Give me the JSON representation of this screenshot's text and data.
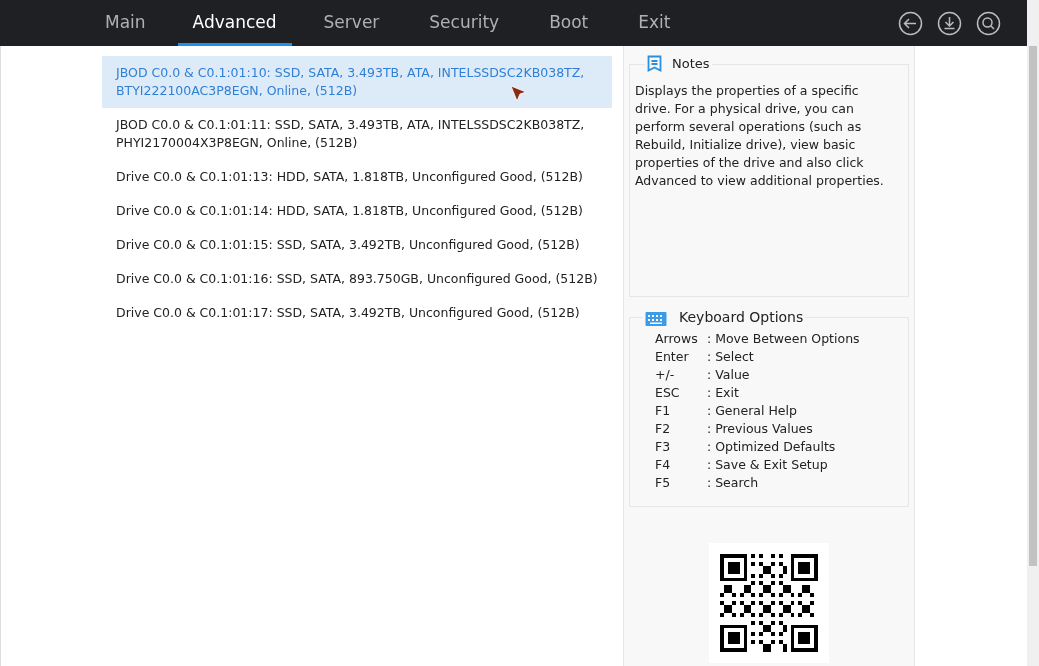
{
  "tabs": [
    {
      "label": "Main",
      "selected": false
    },
    {
      "label": "Advanced",
      "selected": true
    },
    {
      "label": "Server",
      "selected": false
    },
    {
      "label": "Security",
      "selected": false
    },
    {
      "label": "Boot",
      "selected": false
    },
    {
      "label": "Exit",
      "selected": false
    }
  ],
  "drives": [
    {
      "label": "JBOD C0.0 & C0.1:01:10: SSD, SATA, 3.493TB, ATA, INTELSSDSC2KB038TZ, BTYI222100AC3P8EGN, Online, (512B)",
      "selected": true
    },
    {
      "label": "JBOD C0.0 & C0.1:01:11: SSD, SATA, 3.493TB, ATA, INTELSSDSC2KB038TZ, PHYI2170004X3P8EGN, Online, (512B)",
      "selected": false
    },
    {
      "label": "Drive C0.0 & C0.1:01:13: HDD, SATA, 1.818TB, Unconfigured Good, (512B)",
      "selected": false
    },
    {
      "label": "Drive C0.0 & C0.1:01:14: HDD, SATA, 1.818TB, Unconfigured Good, (512B)",
      "selected": false
    },
    {
      "label": "Drive C0.0 & C0.1:01:15: SSD, SATA, 3.492TB, Unconfigured Good, (512B)",
      "selected": false
    },
    {
      "label": "Drive C0.0 & C0.1:01:16: SSD, SATA, 893.750GB, Unconfigured Good, (512B)",
      "selected": false
    },
    {
      "label": "Drive C0.0 & C0.1:01:17: SSD, SATA, 3.492TB, Unconfigured Good, (512B)",
      "selected": false
    }
  ],
  "notes": {
    "title": "Notes",
    "text": "Displays the properties of a specific drive. For a physical drive, you can perform several operations (such as Rebuild, Initialize drive), view basic properties of the drive and also click Advanced to view additional properties."
  },
  "keyboard_options": {
    "title": "Keyboard Options",
    "items": [
      {
        "key": "Arrows",
        "action": ": Move Between Options"
      },
      {
        "key": "Enter",
        "action": ": Select"
      },
      {
        "key": "+/-",
        "action": ": Value"
      },
      {
        "key": "ESC",
        "action": ": Exit"
      },
      {
        "key": "F1",
        "action": ": General Help"
      },
      {
        "key": "F2",
        "action": ": Previous Values"
      },
      {
        "key": "F3",
        "action": ": Optimized Defaults"
      },
      {
        "key": "F4",
        "action": ": Save & Exit Setup"
      },
      {
        "key": "F5",
        "action": ": Search"
      }
    ]
  }
}
